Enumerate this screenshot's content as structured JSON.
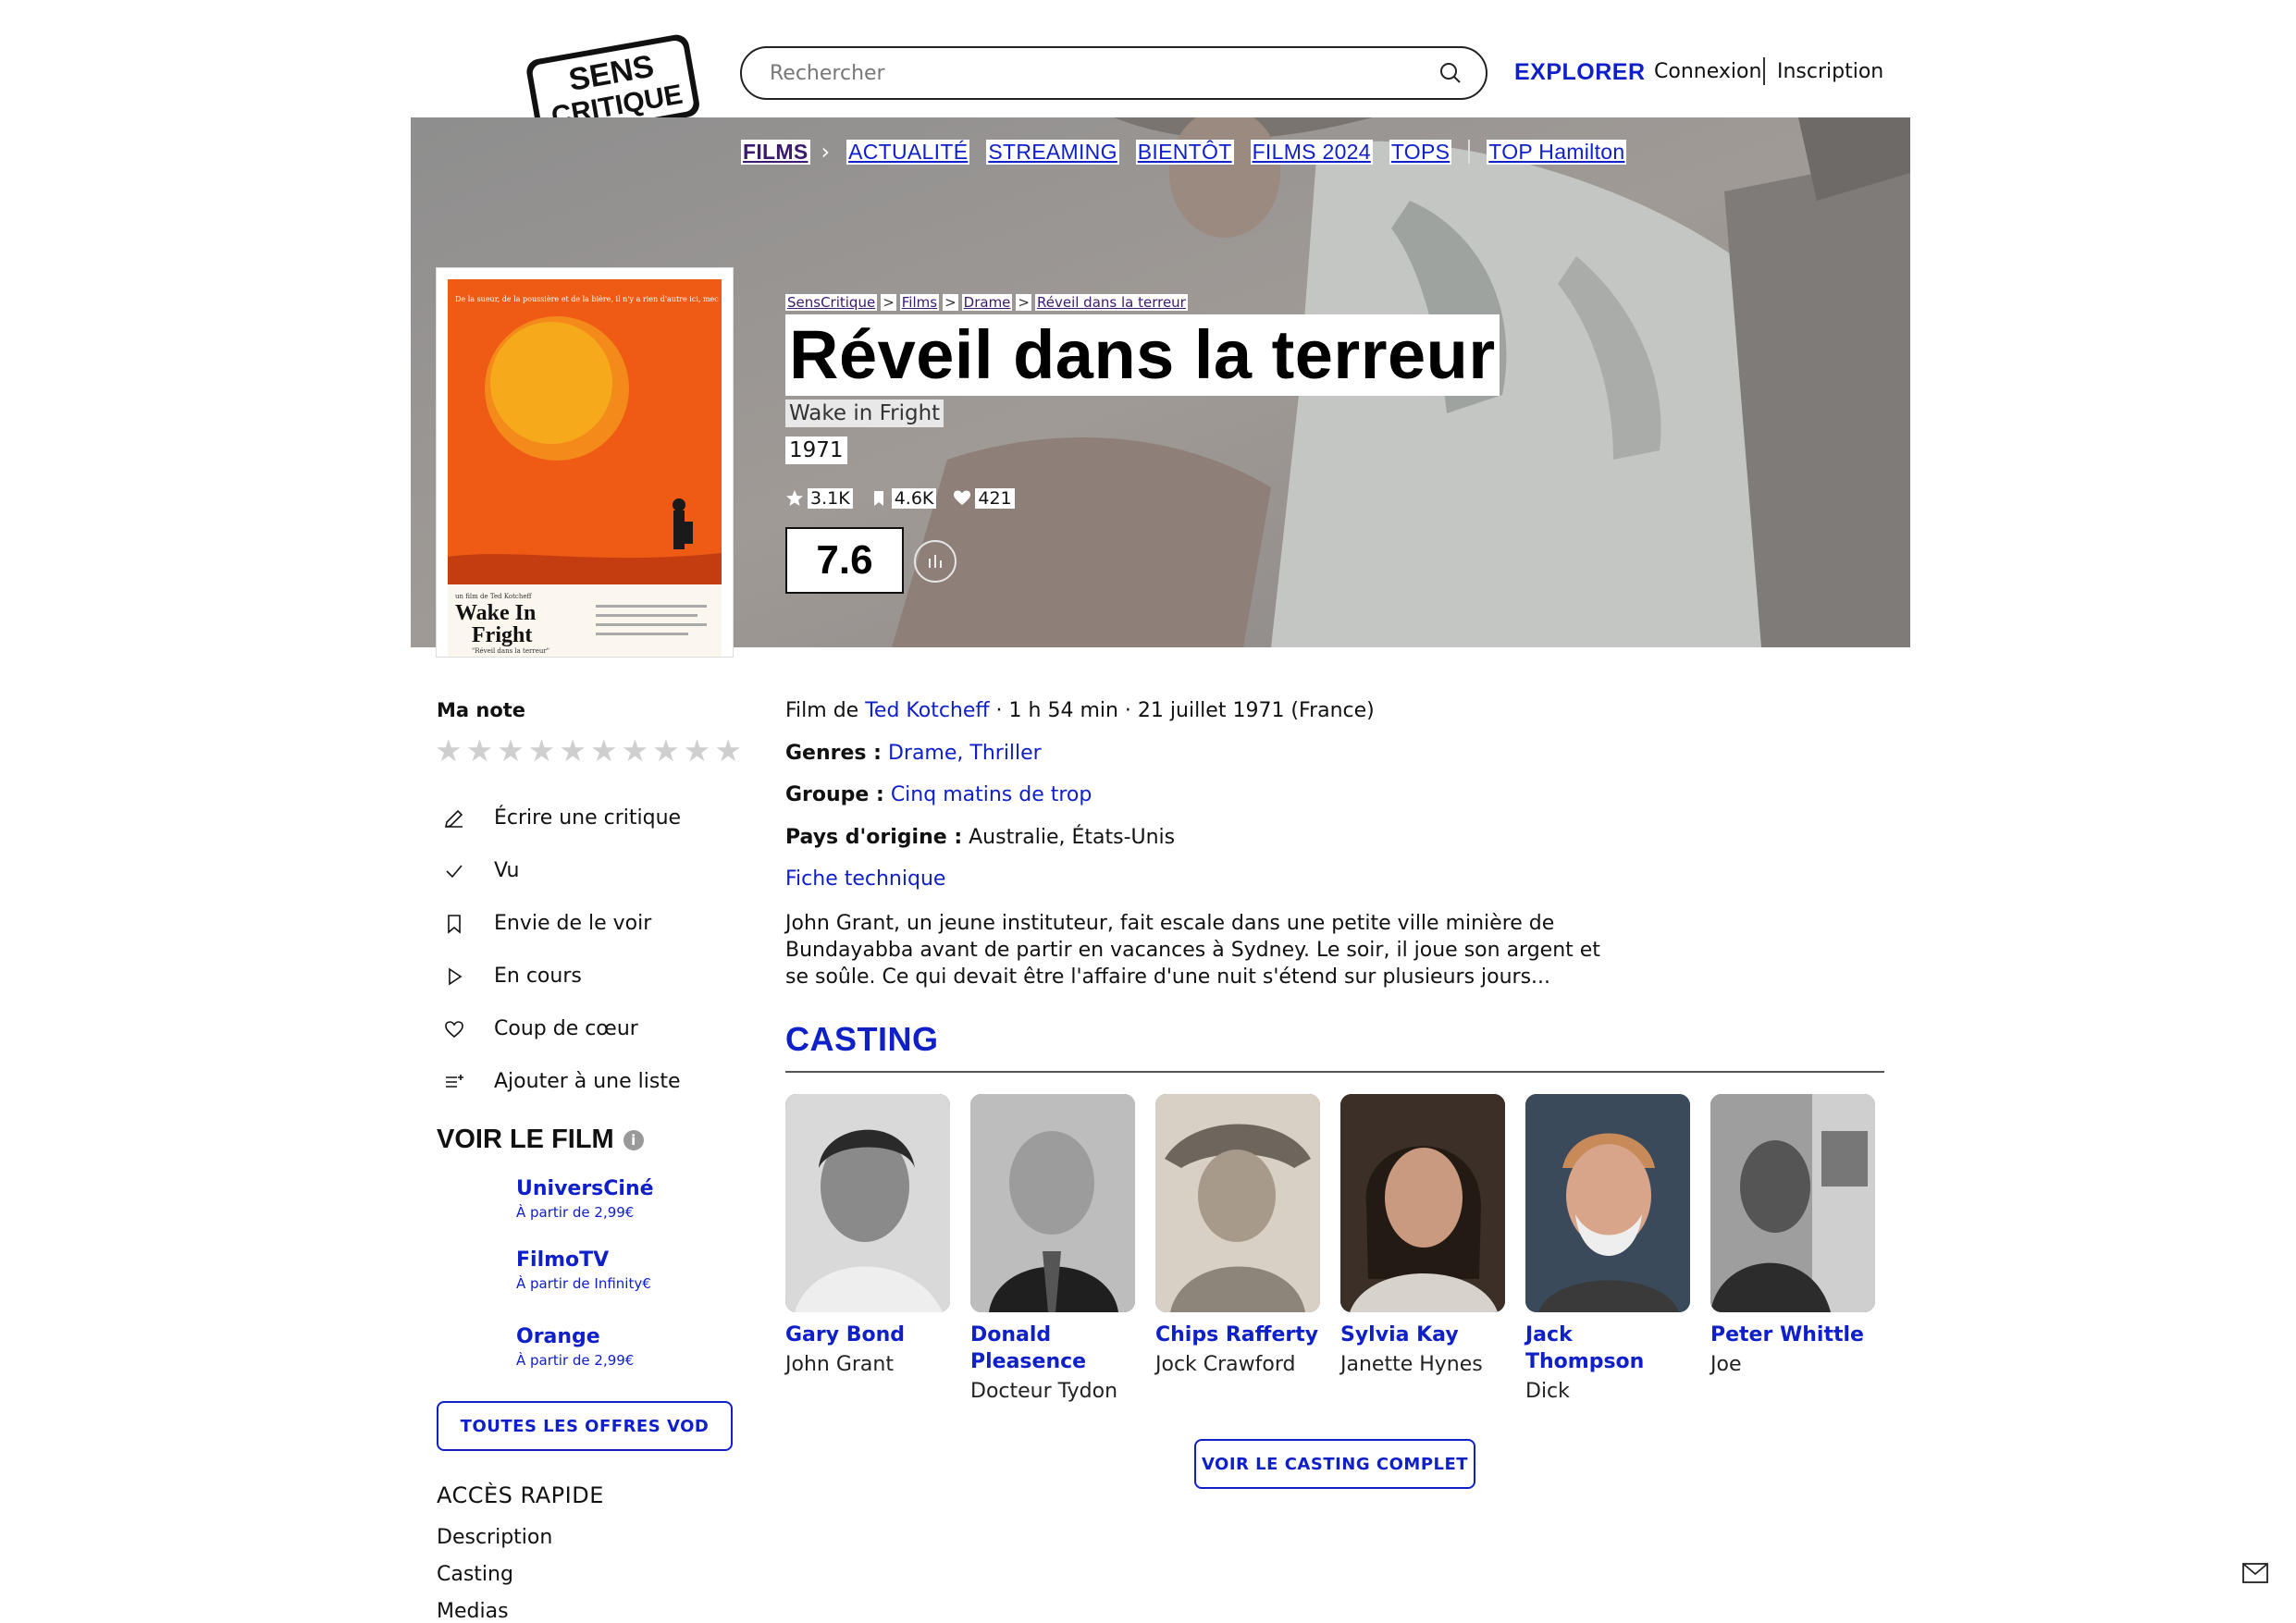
{
  "header": {
    "logo_text_line1": "SENS",
    "logo_text_line2": "CRITIQUE",
    "search_placeholder": "Rechercher",
    "explore_label": "EXPLORER",
    "login_label": "Connexion",
    "signup_label": "Inscription"
  },
  "subnav": {
    "main": "FILMS",
    "items": [
      "ACTUALITÉ",
      "STREAMING",
      "BIENTÔT",
      "FILMS 2024",
      "TOPS",
      "TOP Hamilton"
    ]
  },
  "breadcrumb": [
    "SensCritique",
    "Films",
    "Drame",
    "Réveil dans la terreur"
  ],
  "movie": {
    "title": "Réveil dans la terreur",
    "original_title": "Wake in Fright",
    "year": "1971",
    "stats": {
      "ratings": "3.1K",
      "wishlists": "4.6K",
      "favorites": "421"
    },
    "score": "7.6",
    "poster": {
      "tagline": "De la sueur, de la poussière et de la bière, il n'y a rien d'autre ici, mec !",
      "director_line": "un film de  Ted Kotcheff",
      "title_line1": "Wake In",
      "title_line2": "Fright",
      "french_title": "\"Réveil dans la terreur\""
    },
    "film_by_label": "Film de",
    "director": "Ted Kotcheff",
    "meta": " · 1 h 54 min · 21 juillet 1971 (France)",
    "genres_label": "Genres :",
    "genres": "Drame, Thriller",
    "group_label": "Groupe :",
    "group": "Cinq matins de trop",
    "country_label": "Pays d'origine :",
    "country": "Australie, États-Unis",
    "tech_sheet": "Fiche technique",
    "synopsis": "John Grant, un jeune instituteur, fait escale dans une petite ville minière de Bundayabba avant de partir en vacances à Sydney. Le soir, il joue son argent et se soûle. Ce qui devait être l'affaire d'une nuit s'étend sur plusieurs jours..."
  },
  "my_rating": {
    "label": "Ma note",
    "star_count": 10
  },
  "actions": [
    {
      "label": "Écrire une critique",
      "icon": "pencil-icon"
    },
    {
      "label": "Vu",
      "icon": "check-icon"
    },
    {
      "label": "Envie de le voir",
      "icon": "bookmark-icon"
    },
    {
      "label": "En cours",
      "icon": "play-icon"
    },
    {
      "label": "Coup de cœur",
      "icon": "heart-icon"
    },
    {
      "label": "Ajouter à une liste",
      "icon": "list-add-icon"
    }
  ],
  "watch": {
    "title": "VOIR LE FILM",
    "info_icon": "i",
    "offers": [
      {
        "name": "UniversCiné",
        "price": "À partir de 2,99€"
      },
      {
        "name": "FilmoTV",
        "price": "À partir de Infinity€"
      },
      {
        "name": "Orange",
        "price": "À partir de 2,99€"
      }
    ],
    "all_offers_label": "TOUTES LES OFFRES VOD"
  },
  "quick_access": {
    "title": "ACCÈS RAPIDE",
    "links": [
      "Description",
      "Casting",
      "Medias"
    ]
  },
  "casting": {
    "title": "CASTING",
    "members": [
      {
        "name": "Gary Bond",
        "role": "John Grant"
      },
      {
        "name": "Donald Pleasence",
        "role": "Docteur Tydon"
      },
      {
        "name": "Chips Rafferty",
        "role": "Jock Crawford"
      },
      {
        "name": "Sylvia Kay",
        "role": "Janette Hynes"
      },
      {
        "name": "Jack Thompson",
        "role": "Dick"
      },
      {
        "name": "Peter Whittle",
        "role": "Joe"
      }
    ],
    "full_cast_label": "VOIR LE CASTING COMPLET"
  },
  "colors": {
    "accent": "#1020c8",
    "breadcrumb": "#3a1a6e",
    "poster_orange": "#ef5a14",
    "poster_sun": "#f7a91c"
  }
}
